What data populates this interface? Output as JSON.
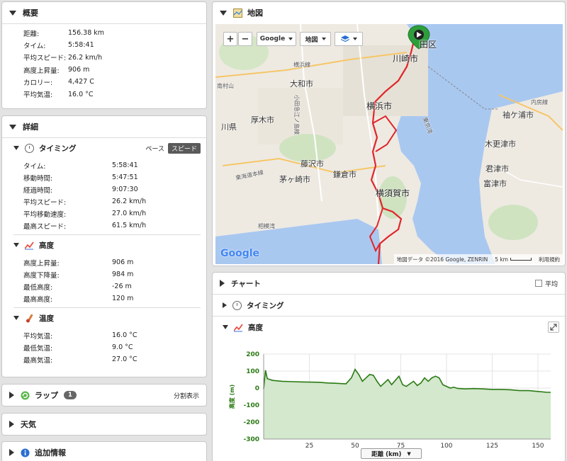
{
  "summary": {
    "title": "概要",
    "rows": [
      {
        "k": "距離:",
        "v": "156.38 km"
      },
      {
        "k": "タイム:",
        "v": "5:58:41"
      },
      {
        "k": "平均スピード:",
        "v": "26.2 km/h"
      },
      {
        "k": "高度上昇量:",
        "v": "906 m"
      },
      {
        "k": "カロリー:",
        "v": "4,427 C"
      },
      {
        "k": "平均気温:",
        "v": "16.0 °C"
      }
    ]
  },
  "details": {
    "title": "詳細",
    "timing": {
      "title": "タイミング",
      "toggle_pace": "ペース",
      "toggle_speed": "スピード",
      "rows": [
        {
          "k": "タイム:",
          "v": "5:58:41"
        },
        {
          "k": "移動時間:",
          "v": "5:47:51"
        },
        {
          "k": "経過時間:",
          "v": "9:07:30"
        },
        {
          "k": "平均スピード:",
          "v": "26.2 km/h"
        },
        {
          "k": "平均移動速度:",
          "v": "27.0 km/h"
        },
        {
          "k": "最高スピード:",
          "v": "61.5 km/h"
        }
      ]
    },
    "elevation": {
      "title": "高度",
      "rows": [
        {
          "k": "高度上昇量:",
          "v": "906 m"
        },
        {
          "k": "高度下降量:",
          "v": "984 m"
        },
        {
          "k": "最低高度:",
          "v": "-26 m"
        },
        {
          "k": "最高高度:",
          "v": "120 m"
        }
      ]
    },
    "temperature": {
      "title": "温度",
      "rows": [
        {
          "k": "平均気温:",
          "v": "16.0 °C"
        },
        {
          "k": "最低気温:",
          "v": "9.0 °C"
        },
        {
          "k": "最高気温:",
          "v": "27.0 °C"
        }
      ]
    }
  },
  "laps": {
    "title": "ラップ",
    "count": "1",
    "split_label": "分割表示"
  },
  "weather": {
    "title": "天気"
  },
  "extra": {
    "title": "追加情報"
  },
  "map": {
    "title": "地図",
    "zoom_in": "+",
    "zoom_out": "−",
    "provider_button": "Google",
    "type_button": "地図",
    "labels": [
      {
        "t": "田区",
        "cls": "big"
      },
      {
        "t": "川崎市",
        "cls": "big"
      },
      {
        "t": "横浜線",
        "cls": "sm"
      },
      {
        "t": "大和市",
        "cls": ""
      },
      {
        "t": "横浜市",
        "cls": "big"
      },
      {
        "t": "厚木市",
        "cls": ""
      },
      {
        "t": "川県",
        "cls": ""
      },
      {
        "t": "藤沢市",
        "cls": ""
      },
      {
        "t": "茅ヶ崎市",
        "cls": ""
      },
      {
        "t": "鎌倉市",
        "cls": ""
      },
      {
        "t": "東海道本線",
        "cls": "sm"
      },
      {
        "t": "横須賀市",
        "cls": "big"
      },
      {
        "t": "相模湾",
        "cls": "sm"
      },
      {
        "t": "袖ケ浦市",
        "cls": ""
      },
      {
        "t": "木更津市",
        "cls": ""
      },
      {
        "t": "君津市",
        "cls": ""
      },
      {
        "t": "富津市",
        "cls": ""
      },
      {
        "t": "内房線",
        "cls": "sm"
      },
      {
        "t": "小田急江ノ島線",
        "cls": "sm"
      },
      {
        "t": "東京湾",
        "cls": "sm"
      },
      {
        "t": "南村山",
        "cls": "sm"
      }
    ],
    "attribution": "地図データ ©2016 Google, ZENRIN",
    "scale": "5 km",
    "terms": "利用規約",
    "google_logo": "Google",
    "colors": {
      "sea": "#a9c8f0",
      "land": "#eeeae2",
      "route": "#e0262b",
      "marker": "#2e9e3c"
    }
  },
  "chart_panel": {
    "title": "チャート",
    "avg_label": "平均",
    "timing_label": "タイミング",
    "elevation_label": "高度",
    "x_select": "距離 (km)"
  },
  "chart_data": {
    "type": "area",
    "ylabel": "高度 (m)",
    "xlabel": "距離 (km)",
    "xlim": [
      0,
      157
    ],
    "ylim": [
      -300,
      200
    ],
    "xticks": [
      25,
      50,
      75,
      100,
      125,
      150
    ],
    "yticks": [
      200,
      100,
      0,
      -100,
      -200,
      -300
    ],
    "color": "#2a7a14",
    "fill": "#d3e8cc",
    "x": [
      0,
      1,
      2,
      5,
      10,
      15,
      20,
      25,
      30,
      35,
      40,
      45,
      48,
      50,
      52,
      54,
      56,
      58,
      60,
      62,
      64,
      66,
      68,
      70,
      72,
      74,
      76,
      78,
      80,
      82,
      84,
      86,
      88,
      90,
      92,
      94,
      96,
      98,
      100,
      102,
      104,
      106,
      110,
      115,
      120,
      125,
      130,
      135,
      140,
      145,
      150,
      155,
      157
    ],
    "y": [
      -5,
      105,
      55,
      45,
      40,
      38,
      36,
      35,
      34,
      30,
      28,
      25,
      60,
      110,
      80,
      40,
      60,
      80,
      75,
      40,
      10,
      30,
      50,
      20,
      45,
      70,
      20,
      10,
      25,
      40,
      15,
      30,
      60,
      40,
      60,
      70,
      60,
      20,
      10,
      0,
      5,
      -2,
      -5,
      -3,
      -5,
      -8,
      -8,
      -10,
      -15,
      -15,
      -20,
      -25,
      -25
    ]
  }
}
